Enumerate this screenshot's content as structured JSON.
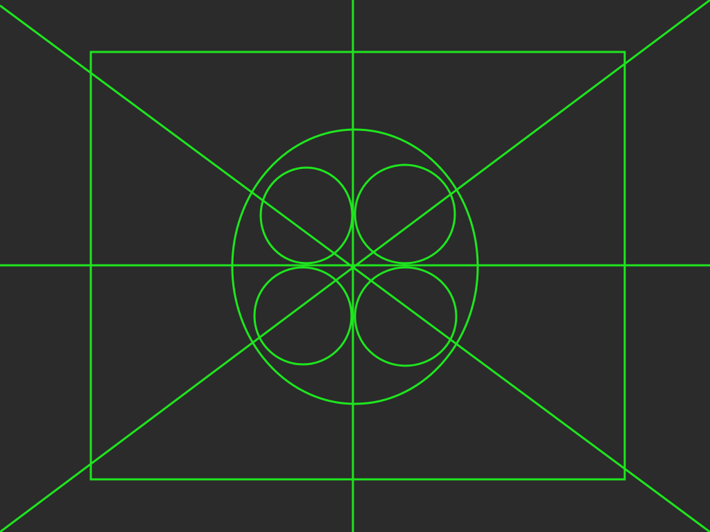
{
  "colors": {
    "background": "#2b2b2b",
    "stroke": "#1ee61e"
  },
  "figure": {
    "frame": "outer-rectangle",
    "guides": [
      "center-vertical-line",
      "center-horizontal-line",
      "diagonal-line-a",
      "diagonal-line-b"
    ],
    "shapes": [
      "large-circle",
      "small-circle-top-left",
      "small-circle-top-right",
      "small-circle-bottom-left",
      "small-circle-bottom-right"
    ]
  }
}
